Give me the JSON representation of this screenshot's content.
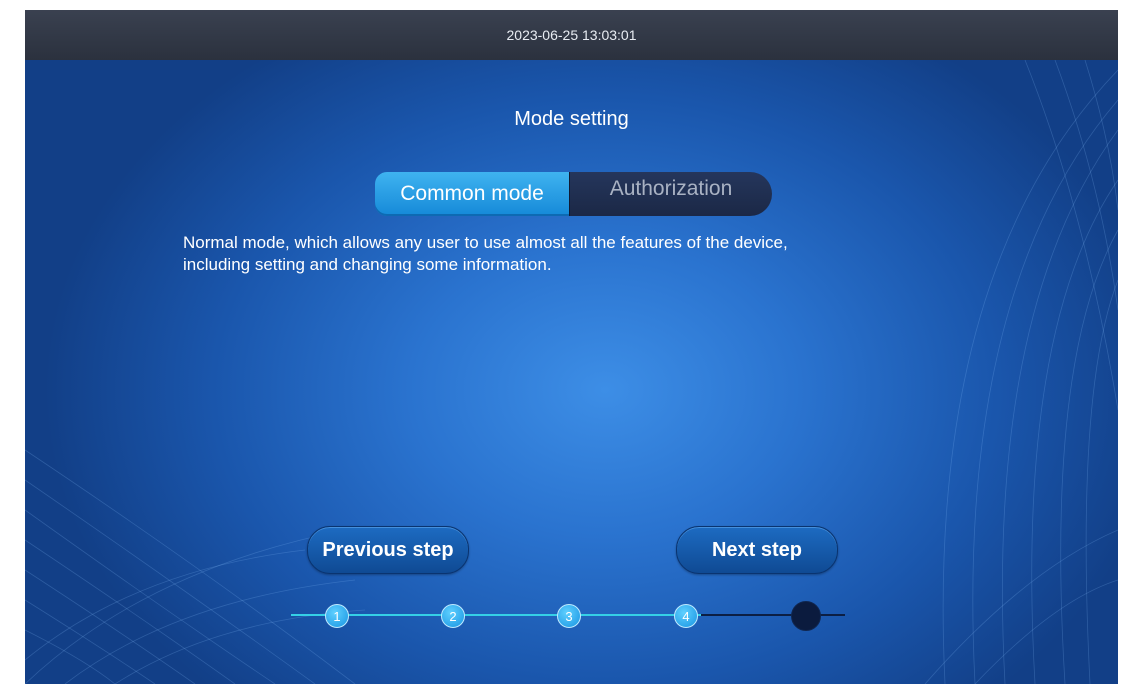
{
  "status_bar": {
    "datetime": "2023-06-25 13:03:01"
  },
  "page": {
    "title": "Mode setting"
  },
  "mode_tabs": [
    {
      "label": "Common mode",
      "selected": true
    },
    {
      "label": "Authorization",
      "selected": false
    }
  ],
  "description": {
    "line1": "Normal mode, which allows any user to use almost all the features of the device,",
    "line2": "including setting and changing some information."
  },
  "buttons": {
    "previous": "Previous step",
    "next": "Next step"
  },
  "stepper": {
    "steps": [
      "1",
      "2",
      "3",
      "4"
    ],
    "current_step": 5,
    "total_steps": 5
  },
  "colors": {
    "accent": "#1ea0ea",
    "progress_done": "#35d0e6",
    "progress_todo": "#0c1f44"
  }
}
